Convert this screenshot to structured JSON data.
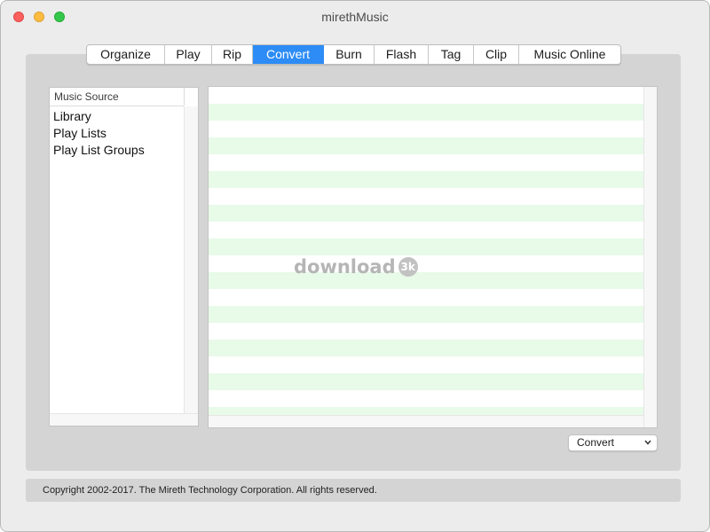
{
  "window": {
    "title": "mirethMusic"
  },
  "tabs": [
    {
      "label": "Organize",
      "active": false
    },
    {
      "label": "Play",
      "active": false
    },
    {
      "label": "Rip",
      "active": false
    },
    {
      "label": "Convert",
      "active": true
    },
    {
      "label": "Burn",
      "active": false
    },
    {
      "label": "Flash",
      "active": false
    },
    {
      "label": "Tag",
      "active": false
    },
    {
      "label": "Clip",
      "active": false
    },
    {
      "label": "Music Online",
      "active": false
    }
  ],
  "music_source": {
    "header": "Music Source",
    "items": [
      "Library",
      "Play Lists",
      "Play List Groups"
    ]
  },
  "watermark": {
    "text": "download",
    "badge": "3k"
  },
  "action_select": {
    "value": "Convert"
  },
  "footer": {
    "text": "Copyright 2002-2017.  The Mireth Technology Corporation. All rights reserved."
  },
  "colors": {
    "active_tab": "#2d8cf5",
    "stripe": "#e8fae8",
    "panel_bg": "#d4d4d4"
  }
}
